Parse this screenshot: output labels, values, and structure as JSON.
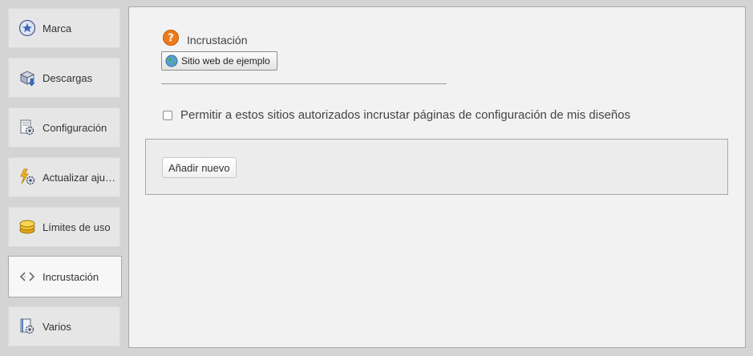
{
  "sidebar": {
    "items": [
      {
        "label": "Marca",
        "icon": "star-badge-icon"
      },
      {
        "label": "Descargas",
        "icon": "download-icon"
      },
      {
        "label": "Configuración",
        "icon": "settings-page-icon"
      },
      {
        "label": "Actualizar ajustes",
        "icon": "update-settings-icon"
      },
      {
        "label": "Límites de uso",
        "icon": "coins-icon"
      },
      {
        "label": "Incrustación",
        "icon": "code-brackets-icon"
      },
      {
        "label": "Varios",
        "icon": "misc-settings-icon"
      }
    ],
    "active_index": 5
  },
  "main": {
    "title": "Incrustación",
    "help_icon": "help-icon",
    "example_button_label": "Sitio web de ejemplo",
    "checkbox_label": "Permitir a estos sitios autorizados incrustar páginas de configuración de mis diseños",
    "checkbox_checked": false,
    "add_button_label": "Añadir nuevo"
  },
  "colors": {
    "help_orange": "#ee7a1a",
    "background": "#d4d4d4",
    "panel": "#f2f2f2"
  }
}
